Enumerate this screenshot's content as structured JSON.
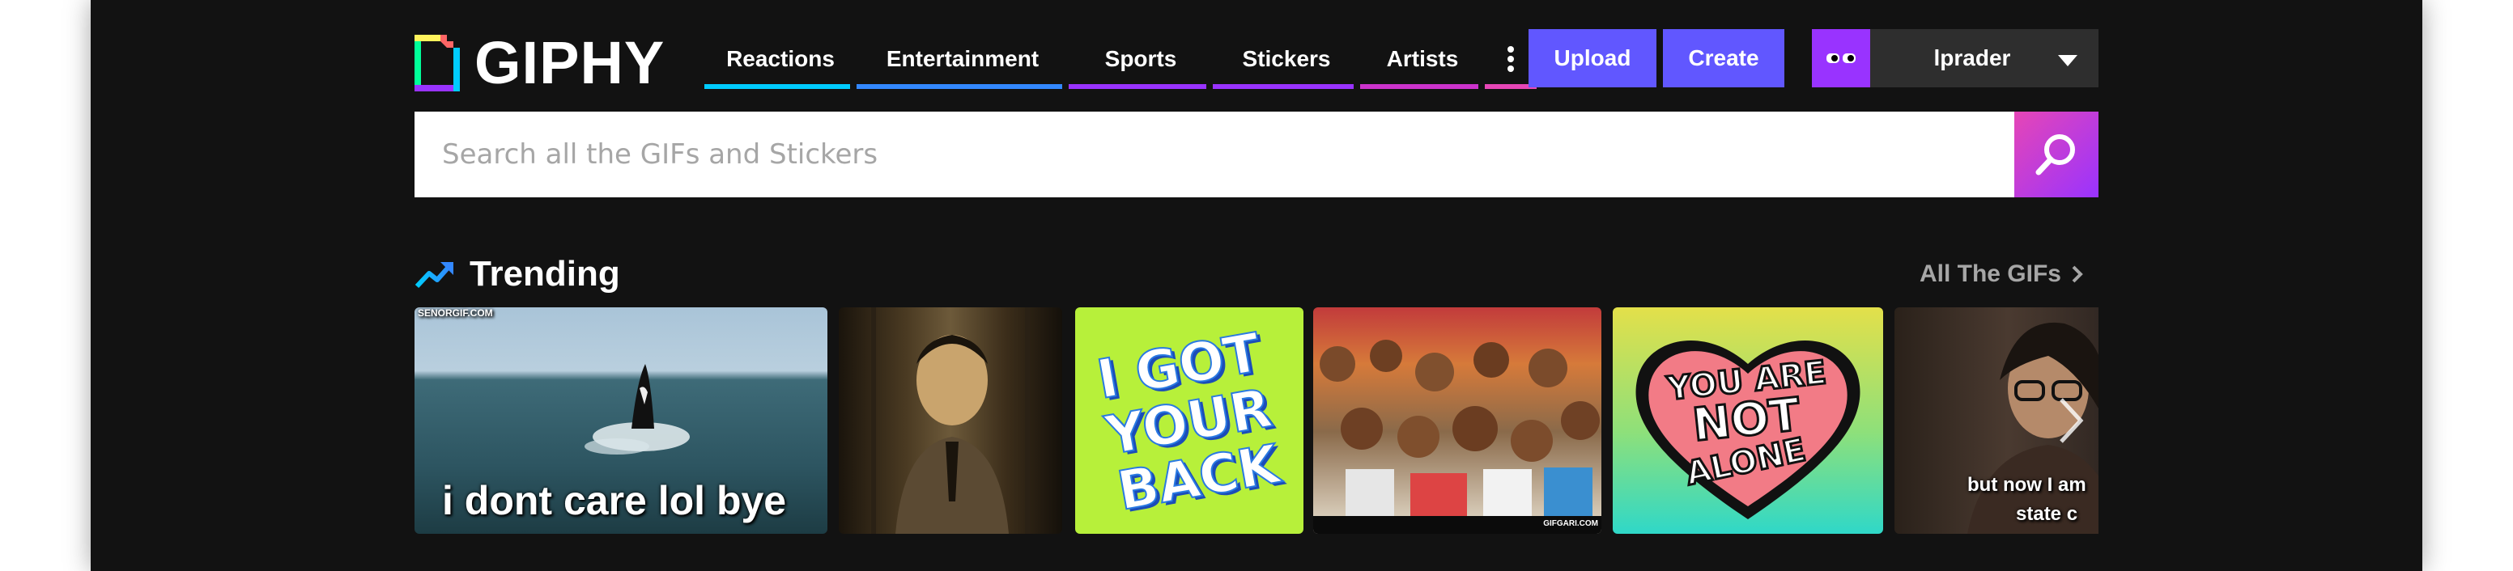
{
  "logo": {
    "text": "GIPHY"
  },
  "nav": {
    "items": [
      {
        "label": "Reactions",
        "color": "#00ccff"
      },
      {
        "label": "Entertainment",
        "color": "#3388ff"
      },
      {
        "label": "Sports",
        "color": "#9933ff"
      },
      {
        "label": "Stickers",
        "color": "#9933ff"
      },
      {
        "label": "Artists",
        "color": "#cc33cc"
      }
    ],
    "more_color": "#e646b6",
    "more_icon": "vertical-ellipsis-icon"
  },
  "actions": {
    "upload_label": "Upload",
    "create_label": "Create",
    "accent": "#6157ff"
  },
  "user": {
    "name": "lprader",
    "avatar_color": "#9933ff"
  },
  "search": {
    "placeholder": "Search all the GIFs and Stickers",
    "value": ""
  },
  "trending": {
    "title": "Trending",
    "all_link": "All The GIFs",
    "gifs": [
      {
        "caption": "i dont care lol bye",
        "watermark": "SENORGIF.COM"
      },
      {
        "caption": ""
      },
      {
        "caption": "",
        "art_text": [
          "I GOT",
          "YOUR",
          "BACK"
        ]
      },
      {
        "caption": "",
        "watermark": "GIFGARI.COM"
      },
      {
        "caption": "",
        "art_text": [
          "YOU ARE",
          "NOT",
          "ALONE"
        ]
      },
      {
        "caption": "but now I am",
        "caption2": "state c"
      }
    ]
  }
}
